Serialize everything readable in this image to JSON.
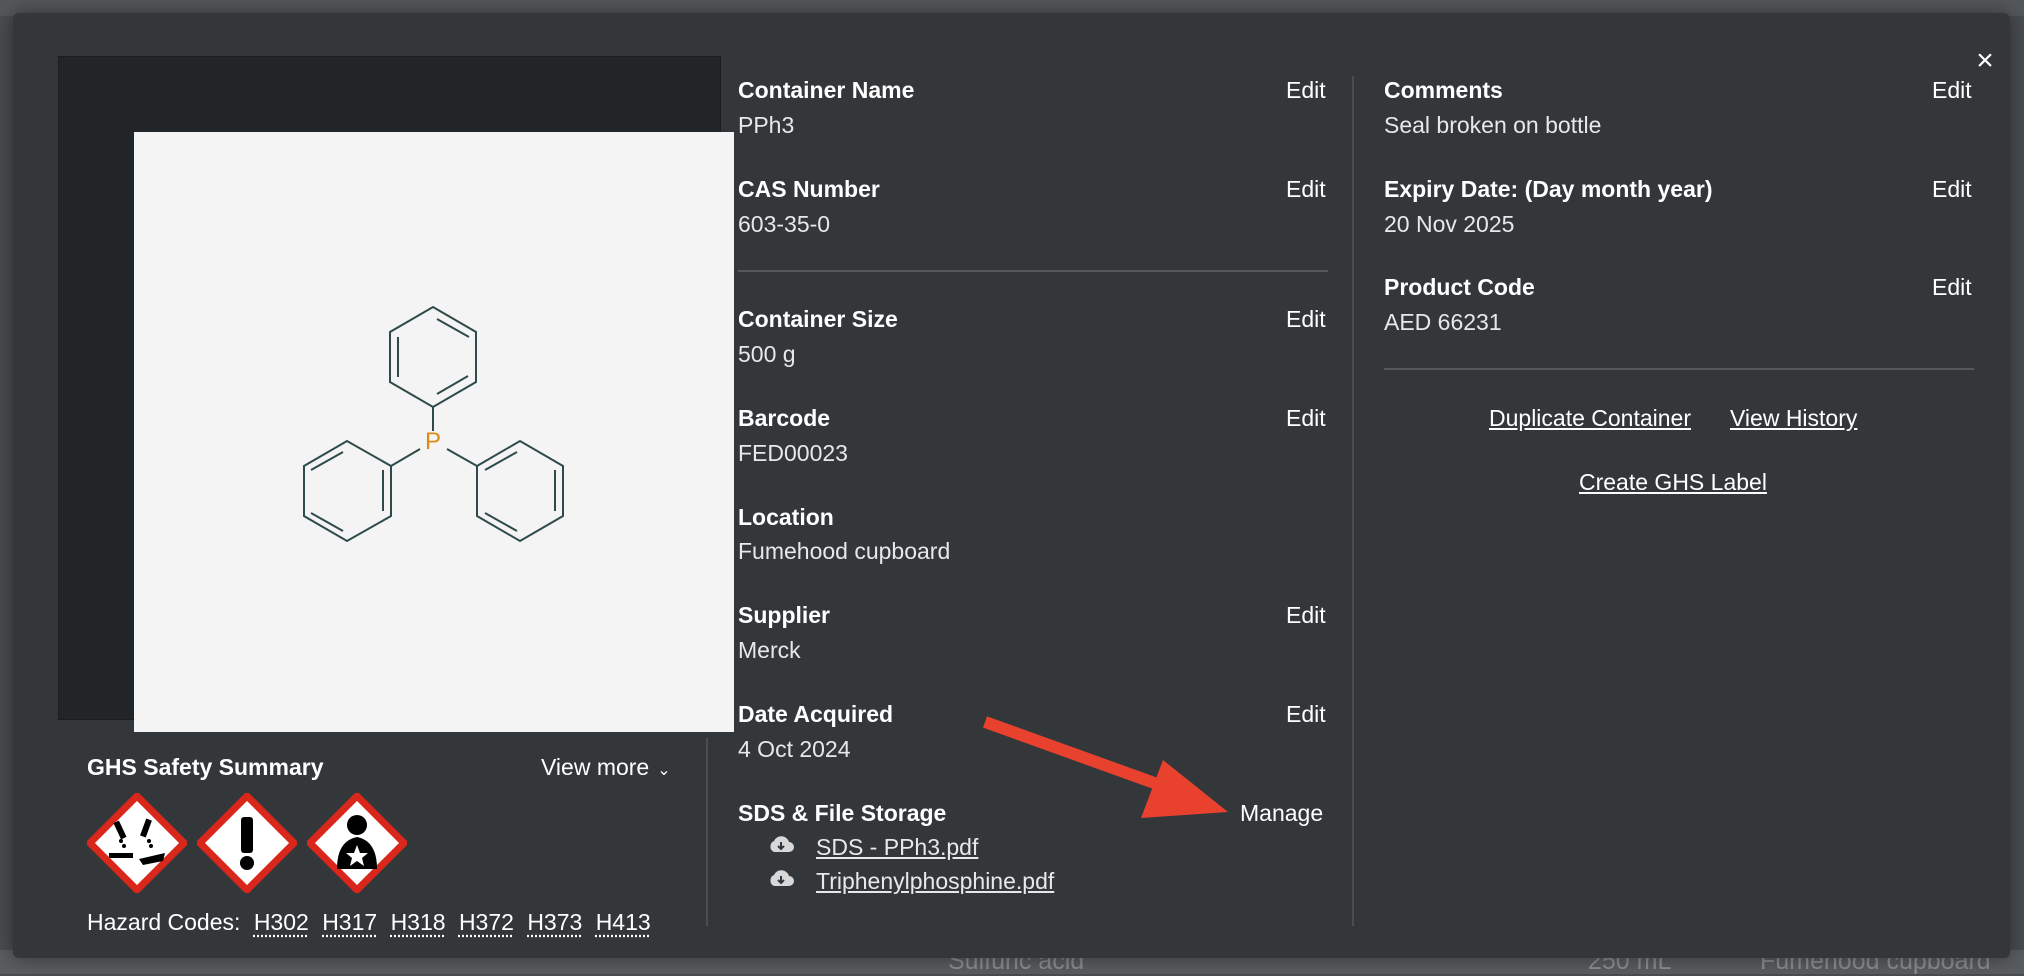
{
  "modal": {
    "close_icon": "×"
  },
  "structure_image": {
    "atom_label": "P"
  },
  "ghs": {
    "title": "GHS Safety Summary",
    "view_more": "View more",
    "chevron": "⌄",
    "pictograms": [
      "corrosion-icon",
      "exclamation-mark-icon",
      "health-hazard-icon"
    ],
    "hazard_codes_label": "Hazard Codes:",
    "hazard_codes": [
      "H302",
      "H317",
      "H318",
      "H372",
      "H373",
      "H413"
    ]
  },
  "fields": {
    "container_name": {
      "label": "Container Name",
      "value": "PPh3",
      "edit": "Edit"
    },
    "cas_number": {
      "label": "CAS Number",
      "value": "603-35-0",
      "edit": "Edit"
    },
    "container_size": {
      "label": "Container Size",
      "value": "500 g",
      "edit": "Edit"
    },
    "barcode": {
      "label": "Barcode",
      "value": "FED00023",
      "edit": "Edit"
    },
    "location": {
      "label": "Location",
      "value": "Fumehood cupboard"
    },
    "supplier": {
      "label": "Supplier",
      "value": "Merck",
      "edit": "Edit"
    },
    "date_acquired": {
      "label": "Date Acquired",
      "value": "4 Oct 2024",
      "edit": "Edit"
    },
    "comments": {
      "label": "Comments",
      "value": "Seal broken on bottle",
      "edit": "Edit"
    },
    "expiry_date": {
      "label": "Expiry Date: (Day month year)",
      "value": "20 Nov 2025",
      "edit": "Edit"
    },
    "product_code": {
      "label": "Product Code",
      "value": "AED 66231",
      "edit": "Edit"
    }
  },
  "sds": {
    "label": "SDS & File Storage",
    "manage": "Manage",
    "files": [
      "SDS - PPh3.pdf",
      "Triphenylphosphine.pdf"
    ]
  },
  "actions": {
    "duplicate": "Duplicate Container",
    "history": "View History",
    "ghs_label": "Create GHS Label"
  },
  "background_row": {
    "name": "Sulfuric acid",
    "size": "250 mL",
    "location": "Fumehood cupboard"
  },
  "colors": {
    "modal_bg": "#34373a",
    "arrow": "#e8412d",
    "atom_p": "#e08a16",
    "bond": "#2e4a4a",
    "ghs_red": "#d9271c"
  }
}
